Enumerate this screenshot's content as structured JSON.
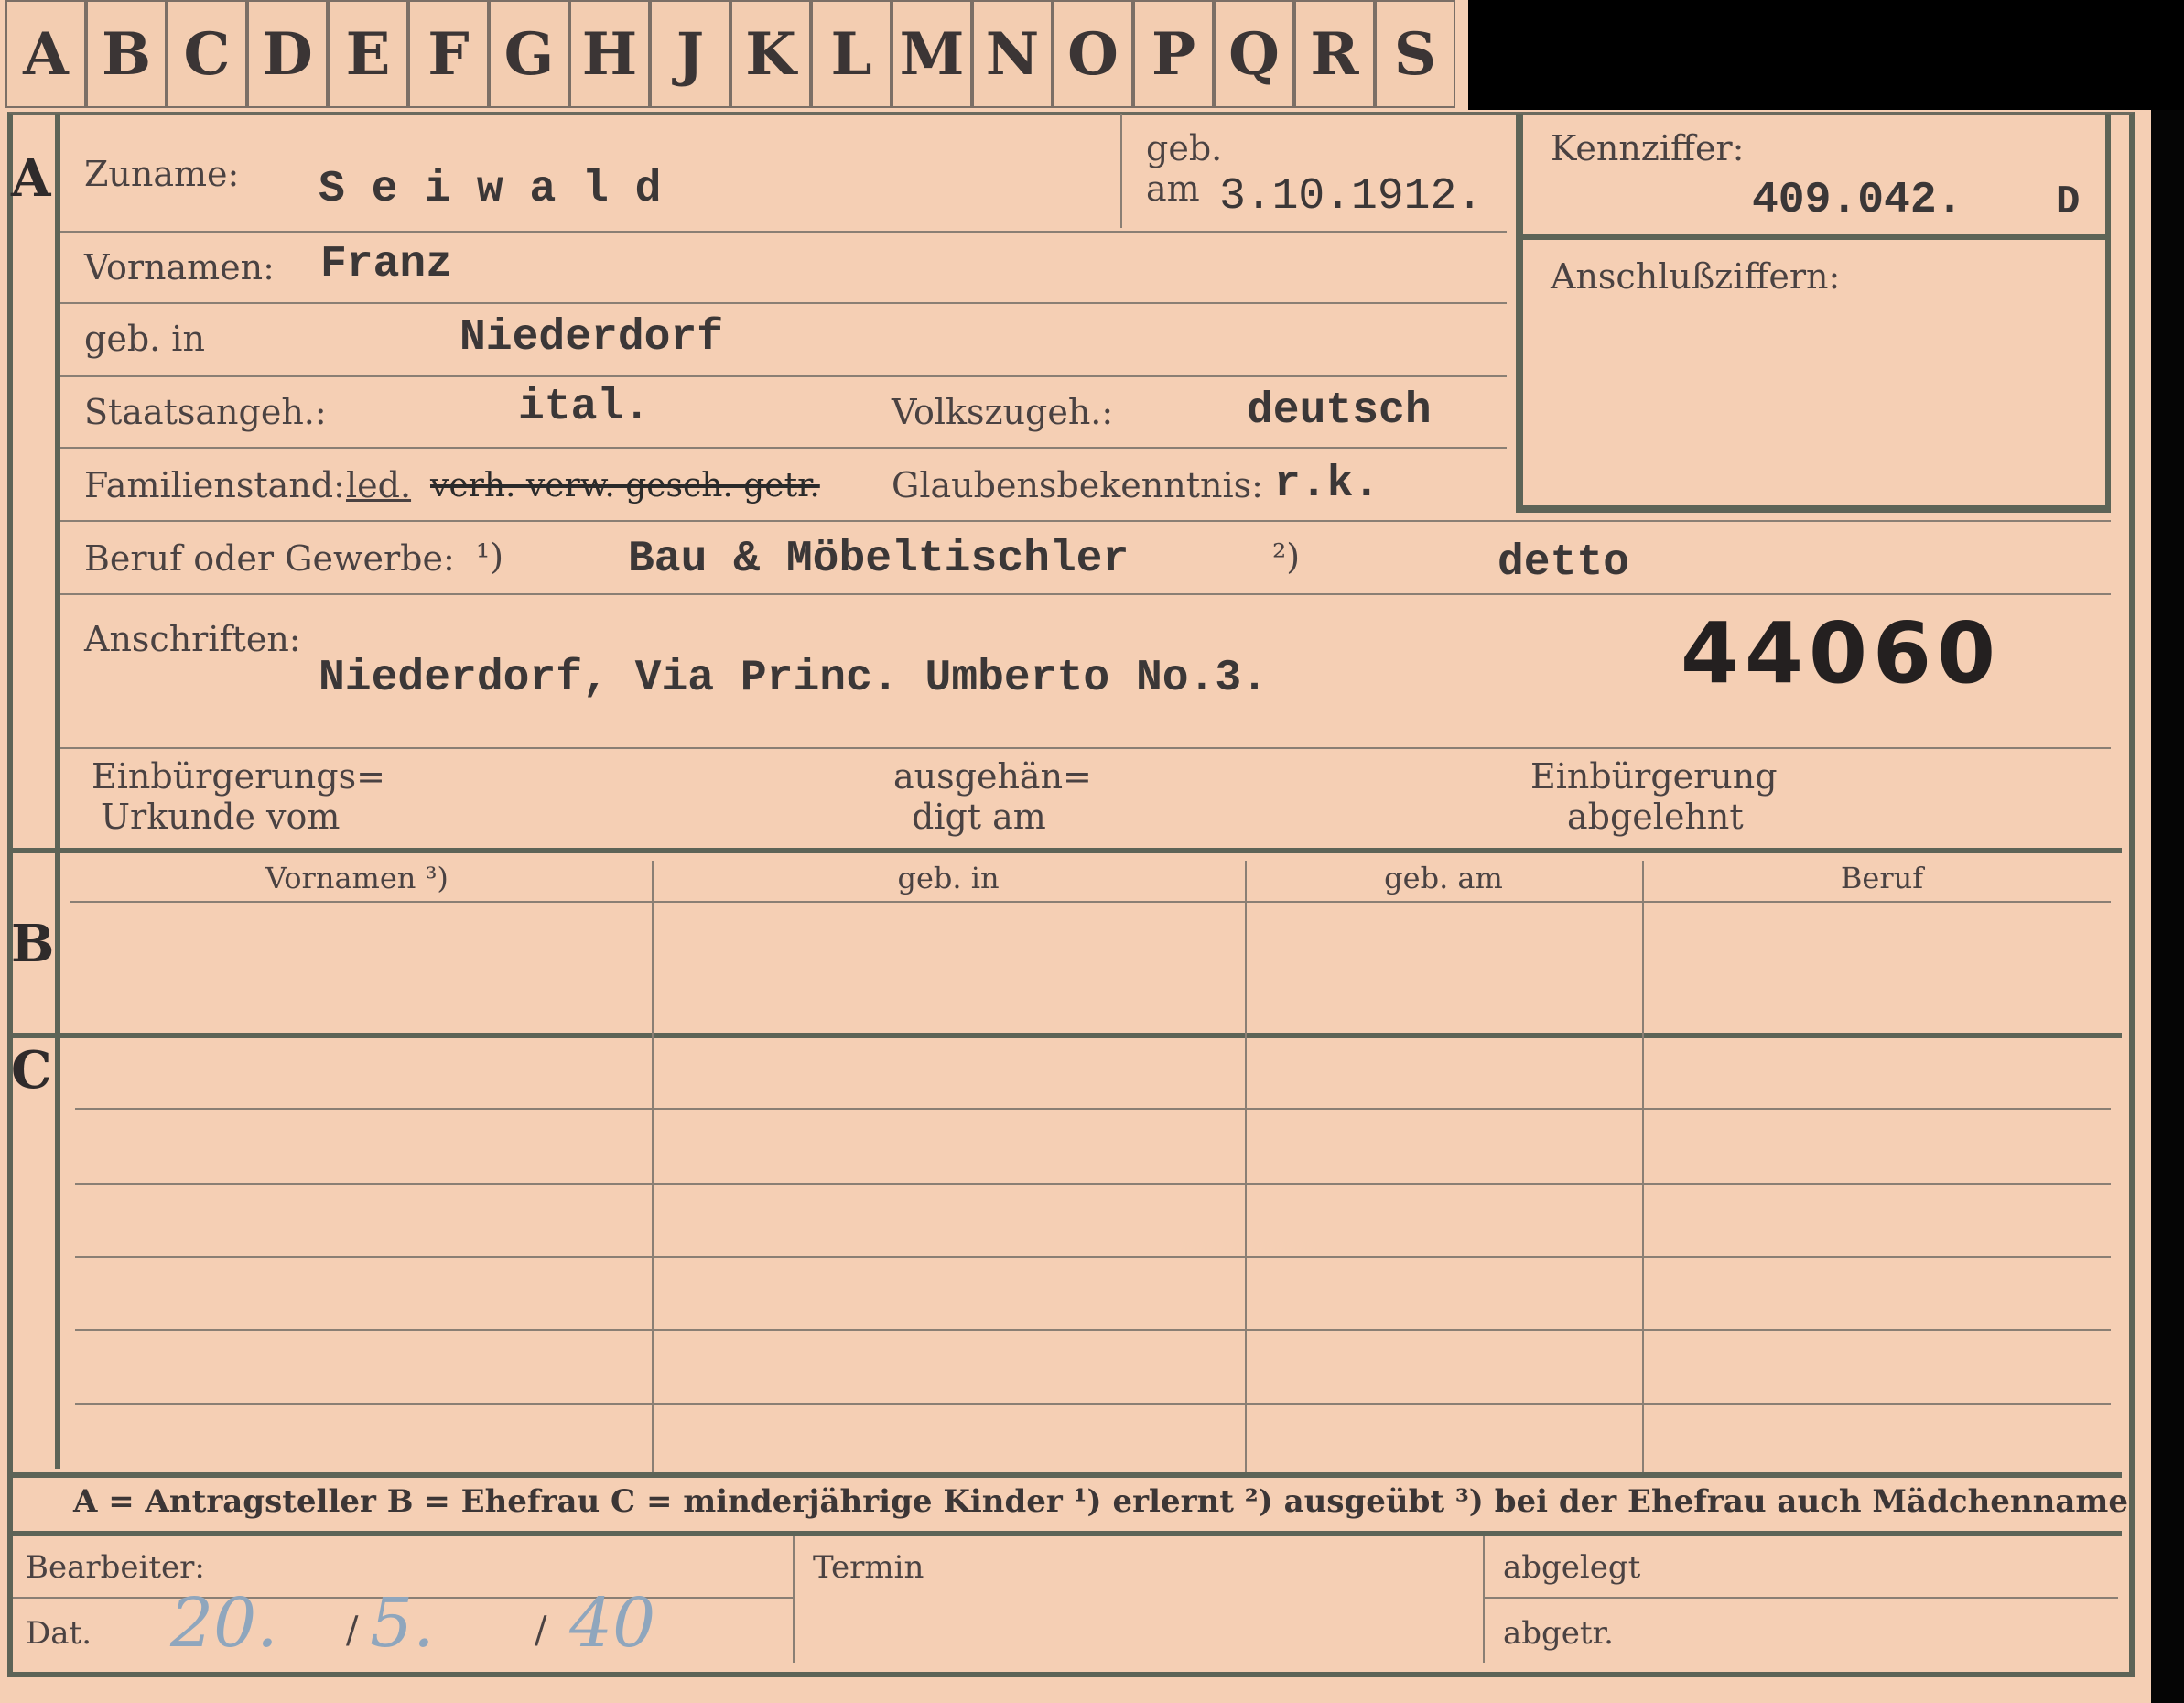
{
  "tabs": [
    "A",
    "B",
    "C",
    "D",
    "E",
    "F",
    "G",
    "H",
    "J",
    "K",
    "L",
    "M",
    "N",
    "O",
    "P",
    "Q",
    "R",
    "S"
  ],
  "rows": {
    "a": "A",
    "b": "B",
    "c": "C"
  },
  "section_a": {
    "zuname_label": "Zuname:",
    "zuname_value": "S e i w a l d",
    "geb_label_1": "geb.",
    "geb_label_2": "am",
    "geb_am_value": "3.10.1912.",
    "vornamen_label": "Vornamen:",
    "vornamen_value": "Franz",
    "geb_in_label": "geb. in",
    "geb_in_value": "Niederdorf",
    "staatsangeh_label": "Staatsangeh.:",
    "staatsangeh_value": "ital.",
    "volkszugeh_label": "Volkszugeh.:",
    "volkszugeh_value": "deutsch",
    "familienstand_label": "Familienstand:",
    "familienstand_value": "led.",
    "familienstand_struck": "verh. verw. gesch. getr.",
    "glaubens_label": "Glaubensbekenntnis:",
    "glaubens_value": "r.k.",
    "beruf_label": "Beruf oder Gewerbe:",
    "beruf_note1": "¹)",
    "beruf_value1": "Bau & Möbeltischler",
    "beruf_note2": "²)",
    "beruf_value2": "detto",
    "anschriften_label": "Anschriften:",
    "anschriften_value": "Niederdorf, Via Princ. Umberto  No.3.",
    "stamp_number": "44060",
    "einb_label_1": "Einbürgerungs=",
    "einb_label_2": "Urkunde vom",
    "ausgeh_label_1": "ausgehän=",
    "ausgeh_label_2": "digt am",
    "abgelehnt_label_1": "Einbürgerung",
    "abgelehnt_label_2": "abgelehnt"
  },
  "kennziffer": {
    "label": "Kennziffer:",
    "value": "409.042.",
    "suffix": "D",
    "anschluss_label": "Anschlußziffern:"
  },
  "table": {
    "headers": [
      "Vornamen ³)",
      "geb. in",
      "geb. am",
      "Beruf"
    ]
  },
  "legend": {
    "text": "A = Antragsteller   B = Ehefrau   C = minderjährige Kinder   ¹) erlernt   ²) ausgeübt   ³) bei der Ehefrau auch Mädchenname"
  },
  "footer": {
    "bearbeiter_label": "Bearbeiter:",
    "termin_label": "Termin",
    "abgelegt_label": "abgelegt",
    "dat_label": "Dat.",
    "dat_day": "20.",
    "dat_month": "5.",
    "dat_year": "40",
    "abgetr_label": "abgetr."
  }
}
